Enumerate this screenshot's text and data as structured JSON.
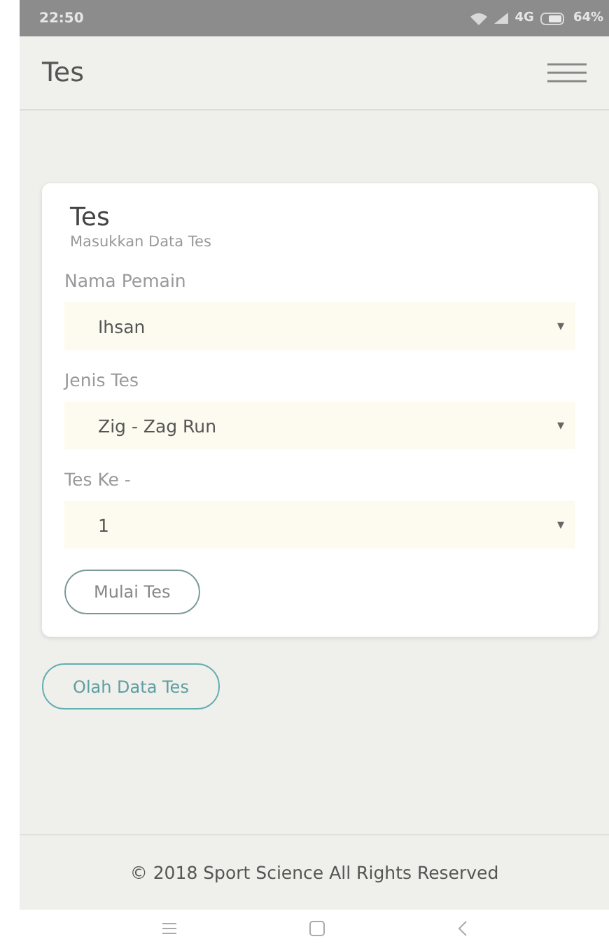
{
  "status_bar": {
    "time": "22:50",
    "network": "4G",
    "battery": "64%"
  },
  "app_bar": {
    "title": "Tes"
  },
  "card": {
    "title": "Tes",
    "subtitle": "Masukkan Data Tes",
    "fields": [
      {
        "label": "Nama Pemain",
        "value": "Ihsan",
        "caret": "▾"
      },
      {
        "label": "Jenis Tes",
        "value": "Zig - Zag Run",
        "caret": "▾"
      },
      {
        "label": "Tes Ke -",
        "value": "1",
        "caret": "▾"
      }
    ],
    "button": "Mulai Tes"
  },
  "secondary_button": "Olah Data Tes",
  "footer": "© 2018 Sport Science All Rights Reserved"
}
